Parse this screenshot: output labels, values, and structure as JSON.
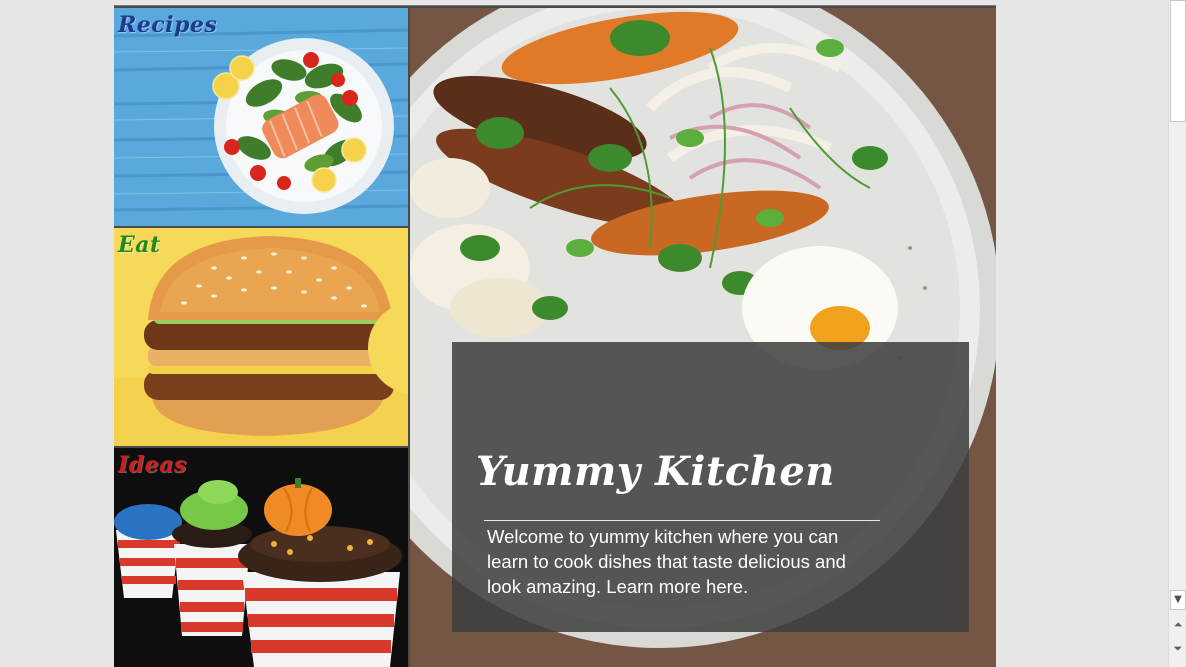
{
  "tiles": {
    "recipes": {
      "label": "Recipes",
      "label_color": "#1b3b8f"
    },
    "eat": {
      "label": "Eat",
      "label_color": "#1f8a1f"
    },
    "ideas": {
      "label": "Ideas",
      "label_color": "#d01c1c"
    }
  },
  "caption": {
    "title": "Yummy Kitchen",
    "body": "Welcome to yummy kitchen where you can learn to cook dishes that taste delicious and look amazing. Learn more here."
  },
  "scrollbar": {
    "down_arrow": "▼",
    "prev_page": "⏶",
    "next_page": "⏷"
  },
  "colors": {
    "caption_bg": "#3e3e3e",
    "recipes_bg": "#5aa9dc",
    "eat_bg": "#f7d95a",
    "ideas_bg": "#111111"
  }
}
